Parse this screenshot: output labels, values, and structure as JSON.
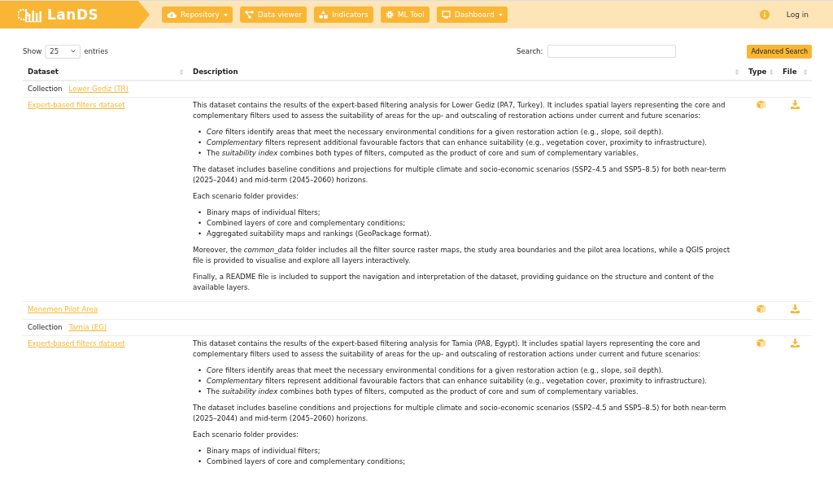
{
  "navbar": {
    "logo": "LanDS",
    "menu": [
      {
        "label": "Repository",
        "dropdown": true
      },
      {
        "label": "Data viewer",
        "dropdown": false
      },
      {
        "label": "Indicators",
        "dropdown": false
      },
      {
        "label": "ML Tool",
        "dropdown": false
      },
      {
        "label": "Dashboard",
        "dropdown": true
      }
    ],
    "login": "Log in"
  },
  "controls": {
    "show_label": "Show",
    "page_length": "25",
    "entries_label": "entries",
    "search_label": "Search:",
    "advanced_search": "Advanced Search"
  },
  "table": {
    "columns": [
      "Dataset",
      "Description",
      "Type",
      "File"
    ],
    "rows": [
      {
        "kind": "collection",
        "label": "Collection",
        "link": "Lower Gediz (TR)"
      },
      {
        "kind": "dataset",
        "name": "Expert-based filters dataset",
        "description": [
          {
            "kind": "p",
            "text": "This dataset contains the results of the expert-based filtering analysis for Lower Gediz (PA7, Turkey). It includes spatial layers representing the core and complementary filters used to assess the suitability of areas for the up- and outscaling of restoration actions under current and future scenarios:"
          },
          {
            "kind": "list",
            "marker": "•",
            "items": [
              "*Core* filters identify areas that meet the necessary environmental conditions for a given restoration action (e.g., slope, soil depth).",
              "*Complementary* filters represent additional favourable factors that can enhance suitability (e.g., vegetation cover, proximity to infrastructure).",
              "The *suitability index* combines both types of filters, computed as the product of core and sum of complementary variables."
            ]
          },
          {
            "kind": "p",
            "text": "The dataset includes baseline conditions and projections for multiple climate and socio-economic scenarios (SSP2–4.5 and SSP5–8.5) for both near-term (2025–2044) and mid-term (2045–2060) horizons."
          },
          {
            "kind": "p",
            "text": "Each scenario folder provides:"
          },
          {
            "kind": "list",
            "marker": "•",
            "items": [
              "Binary maps of individual filters;",
              "Combined layers of core and complementary conditions;",
              "Aggregated suitability maps and rankings (GeoPackage format)."
            ]
          },
          {
            "kind": "p",
            "text": "Moreover, the *common_data* folder includes all the filter source raster maps, the study area boundaries and the pilot area locations, while a QGIS project file is provided to visualise and explore all layers interactively."
          },
          {
            "kind": "p",
            "text": "Finally, a README file is included to support the navigation and interpretation of the dataset, providing guidance on the structure and content of the available layers."
          }
        ]
      },
      {
        "kind": "dataset",
        "name": "Menemen Pilot Area",
        "description": []
      },
      {
        "kind": "collection",
        "label": "Collection",
        "link": "Tamia (EG)"
      },
      {
        "kind": "dataset",
        "name": "Expert-based filters dataset",
        "description": [
          {
            "kind": "p",
            "text": "This dataset contains the results of the expert-based filtering analysis for Tamia (PA8, Egypt). It includes spatial layers representing the core and complementary filters used to assess the suitability of areas for the up- and outscaling of restoration actions under current and future scenarios:"
          },
          {
            "kind": "list",
            "marker": "•",
            "items": [
              "*Core* filters identify areas that meet the necessary environmental conditions for a given restoration action (e.g., slope, soil depth).",
              "*Complementary* filters represent additional favourable factors that can enhance suitability (e.g., vegetation cover, proximity to infrastructure).",
              "The *suitability index* combines both types of filters, computed as the product of core and sum of complementary variables."
            ]
          },
          {
            "kind": "p",
            "text": "The dataset includes baseline conditions and projections for multiple climate and socio-economic scenarios (SSP2–4.5 and SSP5–8.5) for both near-term (2025–2044) and mid-term (2045–2060) horizons."
          },
          {
            "kind": "p",
            "text": "Each scenario folder provides:"
          },
          {
            "kind": "list",
            "marker": "•",
            "items": [
              "Binary maps of individual filters;",
              "Combined layers of core and complementary conditions;"
            ]
          }
        ]
      }
    ]
  }
}
